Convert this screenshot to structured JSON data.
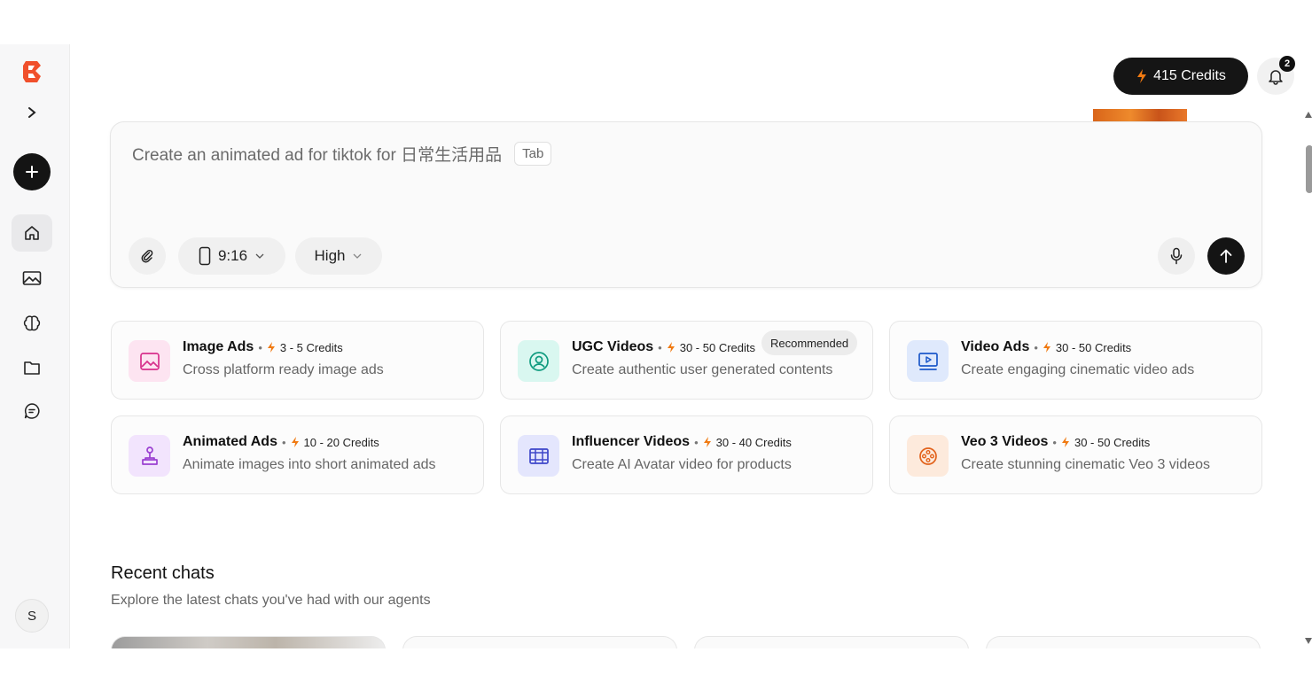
{
  "sidebar": {
    "avatar_initial": "S"
  },
  "header": {
    "credits_label": "415 Credits",
    "notifications_count": "2"
  },
  "prompt": {
    "placeholder": "Create an animated ad for tiktok for 日常生活用品",
    "tab_hint": "Tab",
    "aspect_ratio": "9:16",
    "quality": "High"
  },
  "cards": [
    {
      "title": "Image Ads",
      "credits": "3 - 5 Credits",
      "desc": "Cross platform ready image ads",
      "icon": "image-icon",
      "icon_bg": "#fde4f1",
      "icon_color": "#d7308c"
    },
    {
      "title": "UGC Videos",
      "credits": "30 - 50 Credits",
      "desc": "Create authentic user generated contents",
      "badge": "Recommended",
      "icon": "user-circle-icon",
      "icon_bg": "#d9f7f0",
      "icon_color": "#0f9b7f"
    },
    {
      "title": "Video Ads",
      "credits": "30 - 50 Credits",
      "desc": "Create engaging cinematic video ads",
      "icon": "video-play-icon",
      "icon_bg": "#dfe9fc",
      "icon_color": "#1c58c9"
    },
    {
      "title": "Animated Ads",
      "credits": "10 - 20 Credits",
      "desc": "Animate images into short animated ads",
      "icon": "joystick-icon",
      "icon_bg": "#f2e4fd",
      "icon_color": "#9a3fd1"
    },
    {
      "title": "Influencer Videos",
      "credits": "30 - 40 Credits",
      "desc": "Create AI Avatar video for products",
      "icon": "film-icon",
      "icon_bg": "#e4e6fd",
      "icon_color": "#3e47c9"
    },
    {
      "title": "Veo 3 Videos",
      "credits": "30 - 50 Credits",
      "desc": "Create stunning cinematic Veo 3 videos",
      "icon": "film-reel-icon",
      "icon_bg": "#fdeadc",
      "icon_color": "#e2621b"
    }
  ],
  "recent": {
    "title": "Recent chats",
    "subtitle": "Explore the latest chats you've had with our agents"
  },
  "colors": {
    "accent": "#f07a12",
    "dark": "#141414",
    "brand_logo": "#f0502c"
  }
}
